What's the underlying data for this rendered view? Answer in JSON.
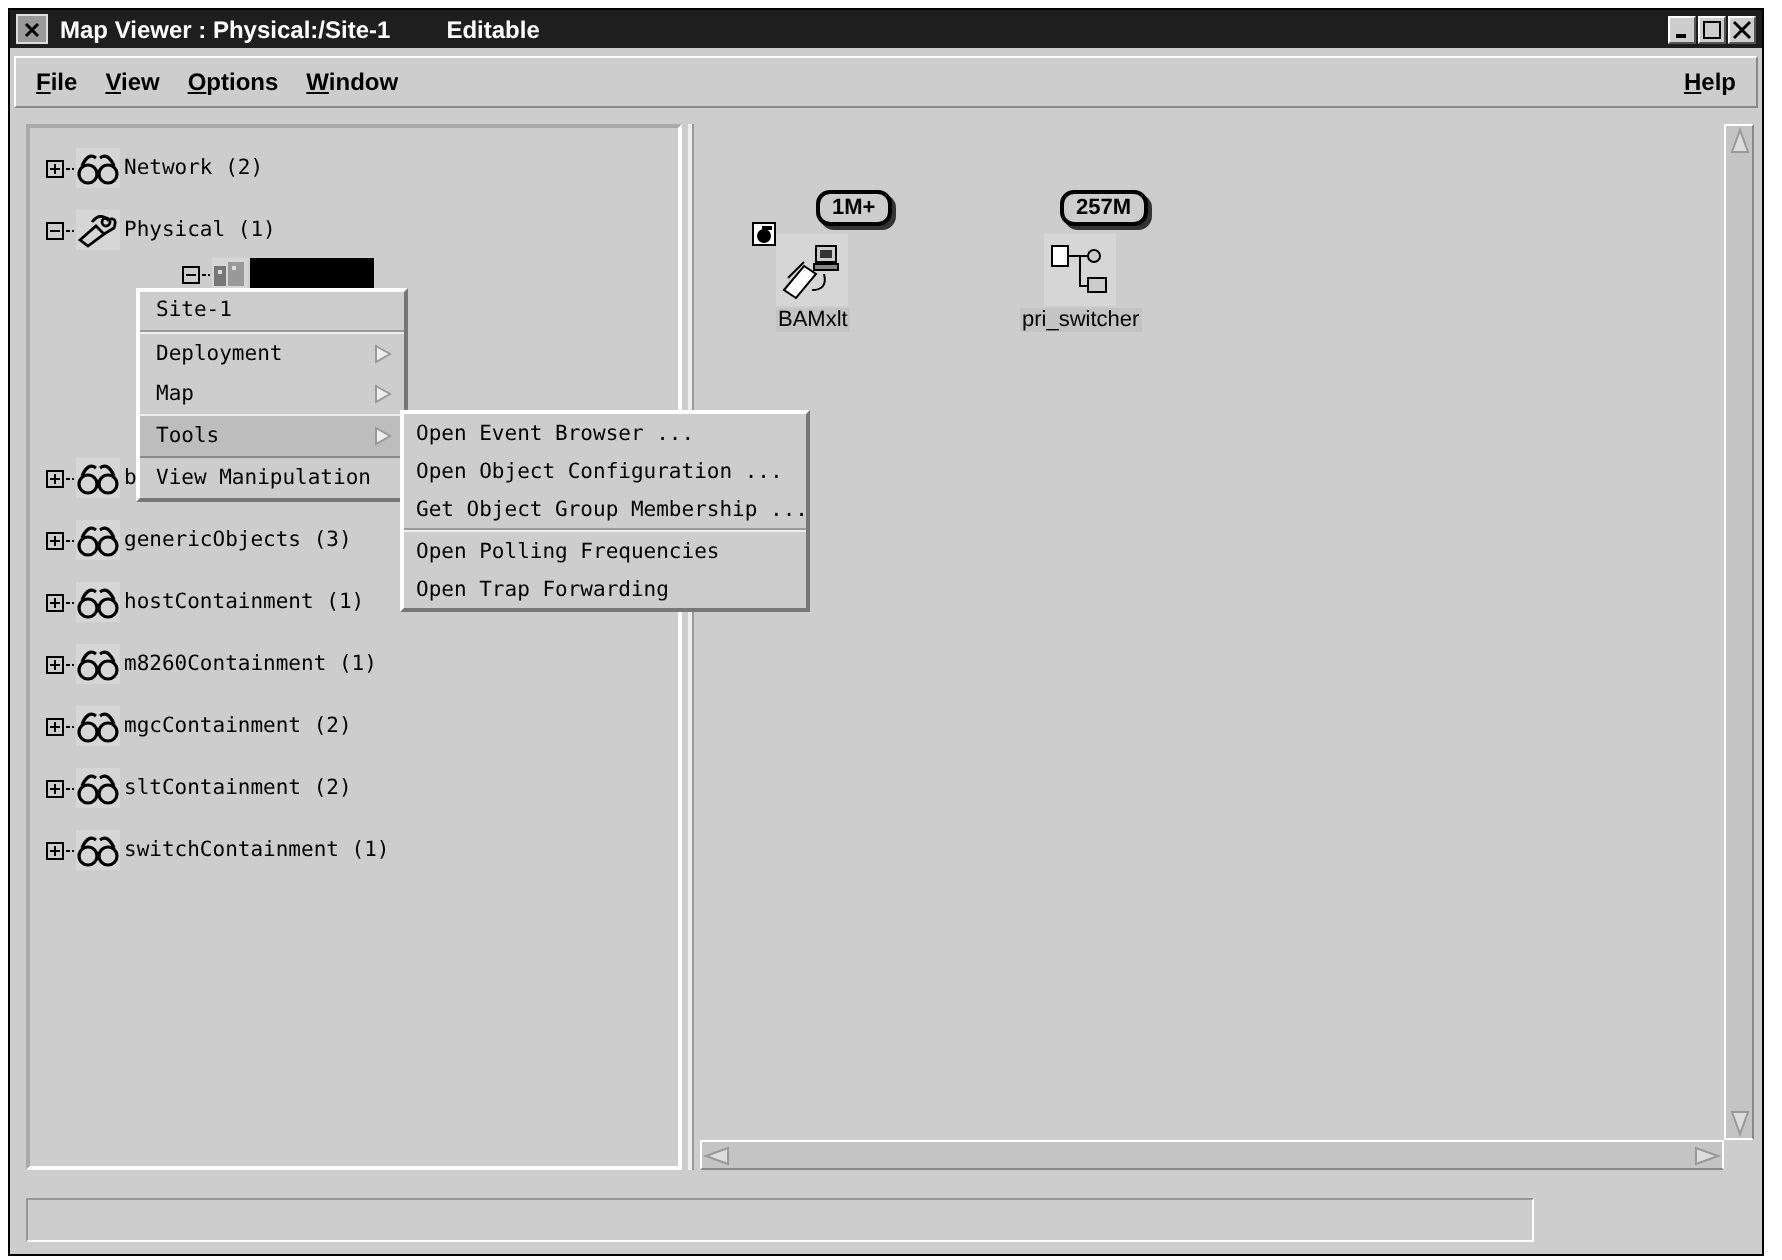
{
  "window": {
    "title": "Map Viewer : Physical:/Site-1",
    "mode": "Editable"
  },
  "menu_bar": {
    "items": [
      "File",
      "View",
      "Options",
      "Window"
    ],
    "help": "Help"
  },
  "tree": [
    {
      "label": "Network (2)",
      "kind": "group",
      "expanded": false,
      "selected": false
    },
    {
      "label": "Physical (1)",
      "kind": "physical",
      "expanded": true,
      "selected": false,
      "children": [
        {
          "kind": "site",
          "expanded": true,
          "selected": true
        }
      ]
    },
    {
      "label": "b",
      "kind": "group",
      "expanded": false,
      "selected": false
    },
    {
      "label": "genericObjects (3)",
      "kind": "group",
      "expanded": false,
      "selected": false
    },
    {
      "label": "hostContainment (1)",
      "kind": "group",
      "expanded": false,
      "selected": false
    },
    {
      "label": "m8260Containment (1)",
      "kind": "group",
      "expanded": false,
      "selected": false
    },
    {
      "label": "mgcContainment (2)",
      "kind": "group",
      "expanded": false,
      "selected": false
    },
    {
      "label": "sltContainment (2)",
      "kind": "group",
      "expanded": false,
      "selected": false
    },
    {
      "label": "switchContainment (1)",
      "kind": "group",
      "expanded": false,
      "selected": false
    }
  ],
  "context_menu": {
    "title": "Site-1",
    "items": [
      {
        "label": "Deployment",
        "selected": false
      },
      {
        "label": "Map",
        "selected": false
      },
      {
        "label": "Tools",
        "selected": true
      },
      {
        "label": "View Manipulation",
        "selected": false
      }
    ]
  },
  "submenu": {
    "groups": [
      [
        "Open Event Browser ...",
        "Open Object Configuration ...",
        "Get Object Group Membership ..."
      ],
      [
        "Open Polling Frequencies",
        "Open Trap Forwarding"
      ]
    ]
  },
  "map_objects": [
    {
      "name": "BAMxlt",
      "badge": "1M+",
      "kind": "workstation",
      "flagged": true
    },
    {
      "name": "pri_switcher",
      "kind": "switch",
      "badge": "257M",
      "flagged": false
    }
  ]
}
